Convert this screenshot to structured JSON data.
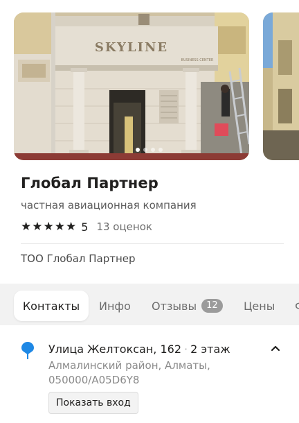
{
  "gallery": {
    "sign_text": "SKYLINE",
    "sign_subtext": "BUSINESS CENTER",
    "photo_count": 4,
    "active_photo": 1
  },
  "org": {
    "title": "Глобал Партнер",
    "category": "частная авиационная компания",
    "rating": {
      "stars": 5,
      "value": "5",
      "reviews_label": "13 оценок"
    },
    "legal_name": "ТОО Глобал Партнер"
  },
  "tabs": [
    {
      "label": "Контакты",
      "active": true
    },
    {
      "label": "Инфо",
      "active": false
    },
    {
      "label": "Отзывы",
      "badge": "12",
      "active": false
    },
    {
      "label": "Цены",
      "active": false
    },
    {
      "label": "Ф",
      "active": false
    }
  ],
  "address": {
    "street": "Улица Желтоксан, 162",
    "floor": "2 этаж",
    "district_line": "Алмалинский район, Алматы, 050000/A05D6Y8",
    "entrance_button": "Показать вход",
    "expanded": true,
    "icon": "pin-icon",
    "pin_color": "#1e88e5"
  },
  "colors": {
    "text_primary": "#21201f",
    "text_secondary": "#8a8a8a",
    "tabs_background": "#f2f2f2",
    "badge_background": "#9b9b9b"
  }
}
